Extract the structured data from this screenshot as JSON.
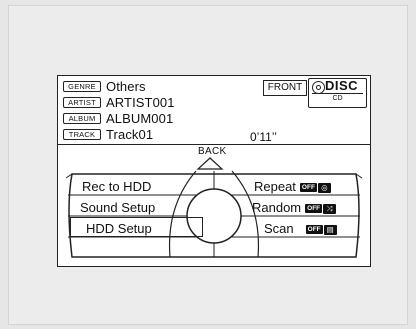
{
  "info": {
    "genre": {
      "tag": "GENRE",
      "value": "Others"
    },
    "artist": {
      "tag": "ARTIST",
      "value": "ARTIST001"
    },
    "album": {
      "tag": "ALBUM",
      "value": "ALBUM001"
    },
    "track": {
      "tag": "TRACK",
      "value": "Track01"
    },
    "time": "0’11’’",
    "source_front": "FRONT",
    "source_disc": "DISC",
    "source_cd": "CD"
  },
  "back_label": "BACK",
  "menu_left": [
    "Rec to HDD",
    "Sound Setup",
    "HDD Setup"
  ],
  "menu_right": [
    {
      "label": "Repeat",
      "badge": "OFF",
      "icon": "repeat-icon",
      "glyph": "◎"
    },
    {
      "label": "Random",
      "badge": "OFF",
      "icon": "shuffle-icon",
      "glyph": "⤨"
    },
    {
      "label": "Scan",
      "badge": "OFF",
      "icon": "scan-icon",
      "glyph": "▤"
    }
  ],
  "selected_item": "HDD Setup"
}
